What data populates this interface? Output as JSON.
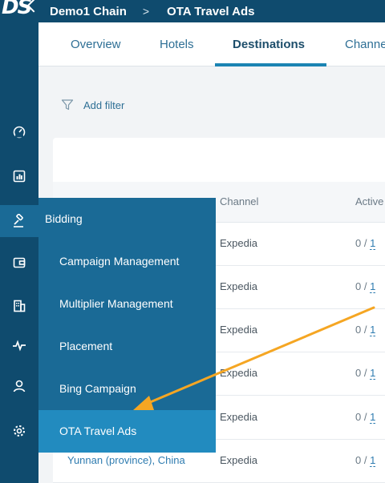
{
  "header": {
    "logo_text": "DS",
    "breadcrumb": [
      "Demo1 Chain",
      "OTA Travel Ads"
    ],
    "separator": ">"
  },
  "tabs": [
    {
      "label": "Overview",
      "active": false
    },
    {
      "label": "Hotels",
      "active": false
    },
    {
      "label": "Destinations",
      "active": true
    },
    {
      "label": "Channels",
      "active": false
    }
  ],
  "filter": {
    "label": "Add filter"
  },
  "table": {
    "columns": [
      "Channel",
      "Active"
    ],
    "rows": [
      {
        "channel": "Expedia",
        "active_num": "0",
        "active_total": "1"
      },
      {
        "channel": "Expedia",
        "active_num": "0",
        "active_total": "1"
      },
      {
        "channel": "Expedia",
        "active_num": "0",
        "active_total": "1"
      },
      {
        "channel": "Expedia",
        "active_num": "0",
        "active_total": "1"
      },
      {
        "channel": "Expedia",
        "active_num": "0",
        "active_total": "1"
      },
      {
        "destination": "Yunnan (province), China",
        "channel": "Expedia",
        "active_num": "0",
        "active_total": "1"
      }
    ]
  },
  "flyout": {
    "title": "Bidding",
    "items": [
      {
        "label": "Campaign Management",
        "selected": false
      },
      {
        "label": "Multiplier Management",
        "selected": false
      },
      {
        "label": "Placement",
        "selected": false
      },
      {
        "label": "Bing Campaign",
        "selected": false
      },
      {
        "label": "OTA Travel Ads",
        "selected": true
      }
    ]
  },
  "sidebar": {
    "icons": [
      "dashboard-gauge-icon",
      "reports-chart-icon",
      "bidding-gavel-icon",
      "wallet-icon",
      "hotel-building-icon",
      "activity-pulse-icon",
      "user-icon",
      "settings-gear-icon"
    ],
    "active_icon": "bidding-gavel-icon"
  },
  "colors": {
    "header_bg": "#0f4b6e",
    "flyout_bg": "#1a6a96",
    "flyout_selected": "#228bbf",
    "tab_active_underline": "#1b84b3",
    "annotation_arrow": "#f5a623"
  }
}
